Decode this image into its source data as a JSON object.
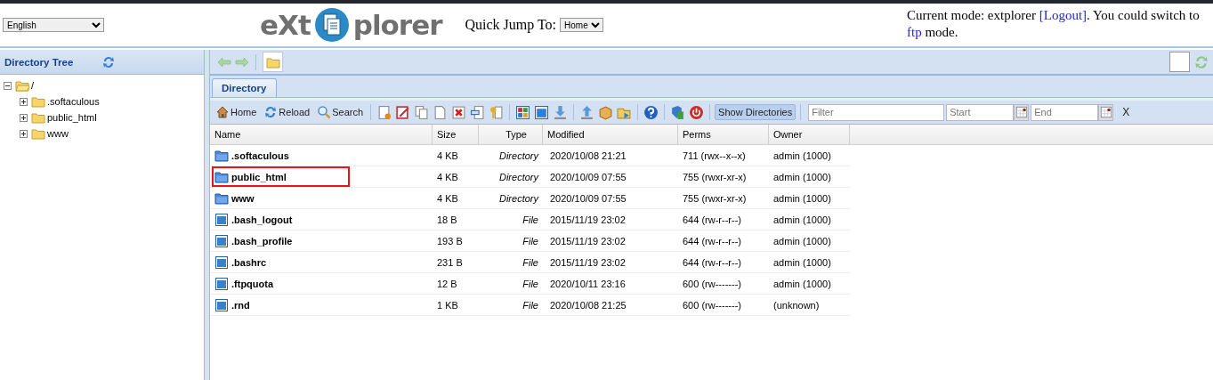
{
  "language_select": {
    "value": "English"
  },
  "logo": {
    "left": "eXt",
    "right": "plorer"
  },
  "quick_jump": {
    "label": "Quick Jump To:",
    "value": "Home"
  },
  "mode_text": {
    "before": "Current mode: extplorer ",
    "logout": "[Logout]",
    "middle": ". You could switch to ",
    "ftp": "ftp",
    "after": " mode."
  },
  "sidebar": {
    "title": "Directory Tree",
    "tree": [
      {
        "label": "/",
        "expanded": true,
        "children": [
          {
            "label": ".softaculous",
            "expanded": false
          },
          {
            "label": "public_html",
            "expanded": false
          },
          {
            "label": "www",
            "expanded": false
          }
        ]
      }
    ]
  },
  "tabs": [
    {
      "label": "Directory",
      "selected": true
    }
  ],
  "toolbar": {
    "buttons": [
      {
        "kind": "home",
        "label": "Home"
      },
      {
        "kind": "reload",
        "label": "Reload"
      },
      {
        "kind": "search",
        "label": "Search"
      }
    ],
    "show_directories": {
      "label": "Show Directories",
      "pressed": true
    },
    "filter": {
      "placeholder": "Filter"
    },
    "start": {
      "placeholder": "Start"
    },
    "end": {
      "placeholder": "End"
    },
    "clear": "X"
  },
  "table": {
    "columns": [
      "Name",
      "Size",
      "Type",
      "Modified",
      "Perms",
      "Owner"
    ],
    "rows": [
      {
        "kind": "folder",
        "name": ".softaculous",
        "size": "4 KB",
        "type": "Directory",
        "modified": "2020/10/08 21:21",
        "perms": "711 (rwx--x--x)",
        "owner": "admin (1000)",
        "highlighted": false
      },
      {
        "kind": "folder",
        "name": "public_html",
        "size": "4 KB",
        "type": "Directory",
        "modified": "2020/10/09 07:55",
        "perms": "755 (rwxr-xr-x)",
        "owner": "admin (1000)",
        "highlighted": true
      },
      {
        "kind": "folder",
        "name": "www",
        "size": "4 KB",
        "type": "Directory",
        "modified": "2020/10/09 07:55",
        "perms": "755 (rwxr-xr-x)",
        "owner": "admin (1000)",
        "highlighted": false
      },
      {
        "kind": "file",
        "name": ".bash_logout",
        "size": "18 B",
        "type": "File",
        "modified": "2015/11/19 23:02",
        "perms": "644 (rw-r--r--)",
        "owner": "admin (1000)",
        "highlighted": false
      },
      {
        "kind": "file",
        "name": ".bash_profile",
        "size": "193 B",
        "type": "File",
        "modified": "2015/11/19 23:02",
        "perms": "644 (rw-r--r--)",
        "owner": "admin (1000)",
        "highlighted": false
      },
      {
        "kind": "file",
        "name": ".bashrc",
        "size": "231 B",
        "type": "File",
        "modified": "2015/11/19 23:02",
        "perms": "644 (rw-r--r--)",
        "owner": "admin (1000)",
        "highlighted": false
      },
      {
        "kind": "file",
        "name": ".ftpquota",
        "size": "12 B",
        "type": "File",
        "modified": "2020/10/11 23:16",
        "perms": "600 (rw-------)",
        "owner": "admin (1000)",
        "highlighted": false
      },
      {
        "kind": "file",
        "name": ".rnd",
        "size": "1 KB",
        "type": "File",
        "modified": "2020/10/08 21:25",
        "perms": "600 (rw-------)",
        "owner": "(unknown)",
        "highlighted": false
      }
    ]
  }
}
